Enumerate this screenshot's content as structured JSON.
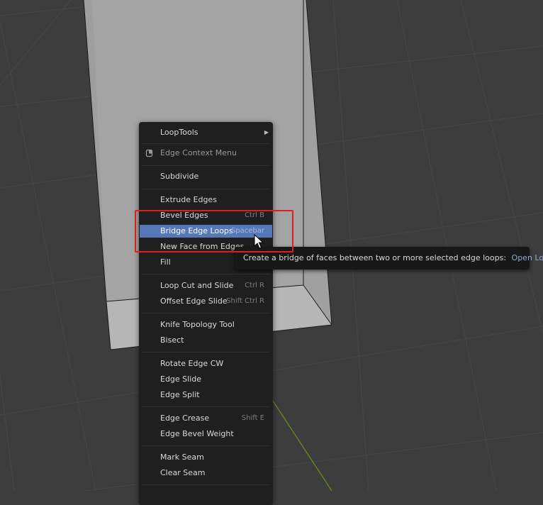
{
  "context_menu": {
    "items": [
      {
        "label": "LoopTools",
        "has_submenu": true
      },
      {
        "label": "Edge Context Menu",
        "icon": "pin-icon"
      },
      {
        "label": "Subdivide"
      },
      {
        "label": "Extrude Edges"
      },
      {
        "label": "Bevel Edges",
        "shortcut": "Ctrl B"
      },
      {
        "label": "Bridge Edge Loops",
        "shortcut": "Spacebar",
        "state": "highlighted"
      },
      {
        "label": "New Face from Edges"
      },
      {
        "label": "Fill"
      },
      {
        "label": "Loop Cut and Slide",
        "shortcut": "Ctrl R"
      },
      {
        "label": "Offset Edge Slide",
        "shortcut": "Shift Ctrl R"
      },
      {
        "label": "Knife Topology Tool"
      },
      {
        "label": "Bisect"
      },
      {
        "label": "Rotate Edge CW"
      },
      {
        "label": "Edge Slide"
      },
      {
        "label": "Edge Split"
      },
      {
        "label": "Edge Crease",
        "shortcut": "Shift E"
      },
      {
        "label": "Edge Bevel Weight"
      },
      {
        "label": "Mark Seam"
      },
      {
        "label": "Clear Seam"
      }
    ]
  },
  "tooltip": {
    "text": "Create a bridge of faces between two or more selected edge loops:",
    "extra": "Open Loop"
  },
  "colors": {
    "viewport_bg": "#3d3d3d",
    "menu_bg": "#1f1f1f",
    "active_item": "#5677b8",
    "annotation_red": "#e01e1e",
    "y_axis_green": "#6a8f1f"
  }
}
